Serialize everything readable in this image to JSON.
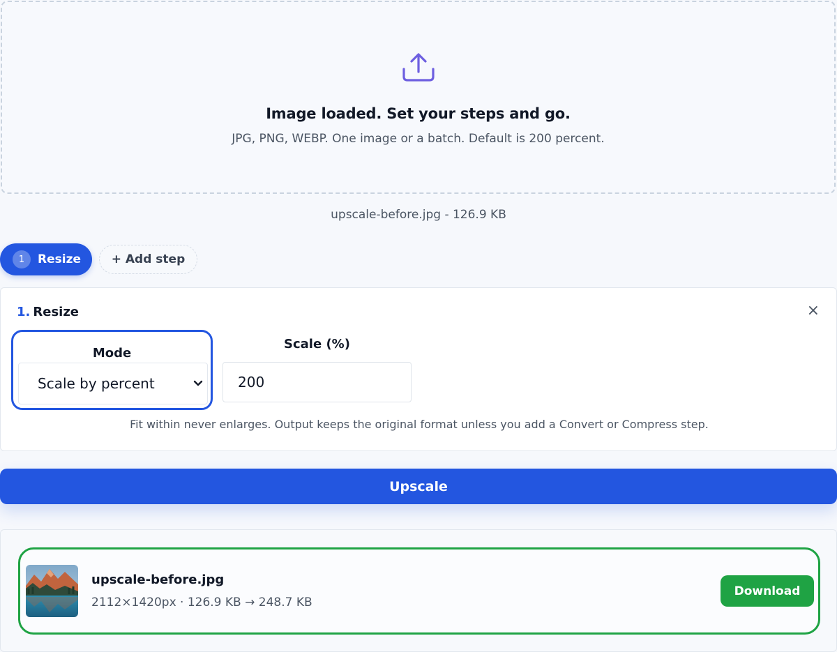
{
  "dropzone": {
    "icon": "upload-icon",
    "title": "Image loaded. Set your steps and go.",
    "subtitle": "JPG, PNG, WEBP. One image or a batch. Default is 200 percent."
  },
  "file_summary": "upscale-before.jpg - 126.9 KB",
  "steps": {
    "tabs": [
      {
        "number": "1",
        "label": "Resize"
      }
    ],
    "add_step_label": "+ Add step"
  },
  "step_card": {
    "number": "1.",
    "title": "Resize",
    "close_icon": "close-icon",
    "mode": {
      "label": "Mode",
      "value": "Scale by percent"
    },
    "scale": {
      "label": "Scale (%)",
      "value": "200"
    },
    "hint": "Fit within never enlarges. Output keeps the original format unless you add a Convert or Compress step."
  },
  "upscale_label": "Upscale",
  "results": [
    {
      "name": "upscale-before.jpg",
      "meta": "2112×1420px · 126.9 KB → 248.7 KB",
      "download_label": "Download"
    }
  ],
  "colors": {
    "primary": "#2356e0",
    "success": "#1fa344",
    "icon_accent": "#6d5fe0"
  }
}
